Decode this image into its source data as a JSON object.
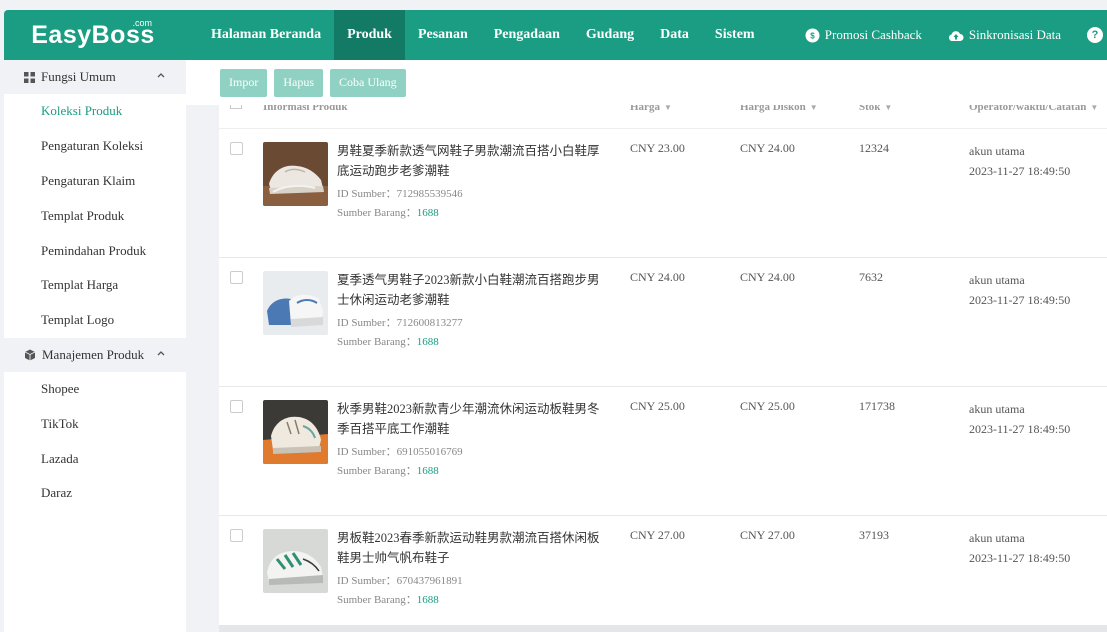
{
  "logo": {
    "text": "EasyBoss",
    "com": ".com"
  },
  "nav": {
    "items": [
      "Halaman Beranda",
      "Produk",
      "Pesanan",
      "Pengadaan",
      "Gudang",
      "Data",
      "Sistem"
    ],
    "active": "Produk",
    "promo": "Promosi Cashback",
    "sync": "Sinkronisasi Data",
    "help": "?"
  },
  "sidebar": {
    "group1": "Fungsi Umum",
    "items1": [
      "Koleksi Produk",
      "Pengaturan Koleksi",
      "Pengaturan Klaim",
      "Templat Produk",
      "Pemindahan Produk",
      "Templat Harga",
      "Templat Logo"
    ],
    "group2": "Manajemen Produk",
    "items2": [
      "Shopee",
      "TikTok",
      "Lazada",
      "Daraz"
    ]
  },
  "toolbar": {
    "impor": "Impor",
    "hapus": "Hapus",
    "coba_ulang": "Coba Ulang"
  },
  "table": {
    "headers": {
      "info": "Informasi Produk",
      "harga": "Harga",
      "diskon": "Harga Diskon",
      "stok": "Stok",
      "operator": "Operator/waktu/Catatan"
    },
    "src_label": "ID Sumber：",
    "sb_label": "Sumber Barang：",
    "rows": [
      {
        "title": "男鞋夏季新款透气网鞋子男款潮流百搭小白鞋厚底运动跑步老爹潮鞋",
        "id": "712985539546",
        "source": "1688",
        "price": "CNY 23.00",
        "discount": "CNY 24.00",
        "stock": "12324",
        "operator": "akun utama",
        "time": "2023-11-27 18:49:50"
      },
      {
        "title": "夏季透气男鞋子2023新款小白鞋潮流百搭跑步男士休闲运动老爹潮鞋",
        "id": "712600813277",
        "source": "1688",
        "price": "CNY 24.00",
        "discount": "CNY 24.00",
        "stock": "7632",
        "operator": "akun utama",
        "time": "2023-11-27 18:49:50"
      },
      {
        "title": "秋季男鞋2023新款青少年潮流休闲运动板鞋男冬季百搭平底工作潮鞋",
        "id": "691055016769",
        "source": "1688",
        "price": "CNY 25.00",
        "discount": "CNY 25.00",
        "stock": "171738",
        "operator": "akun utama",
        "time": "2023-11-27 18:49:50"
      },
      {
        "title": "男板鞋2023春季新款运动鞋男款潮流百搭休闲板鞋男士帅气帆布鞋子",
        "id": "670437961891",
        "source": "1688",
        "price": "CNY 27.00",
        "discount": "CNY 27.00",
        "stock": "37193",
        "operator": "akun utama",
        "time": "2023-11-27 18:49:50"
      }
    ]
  }
}
